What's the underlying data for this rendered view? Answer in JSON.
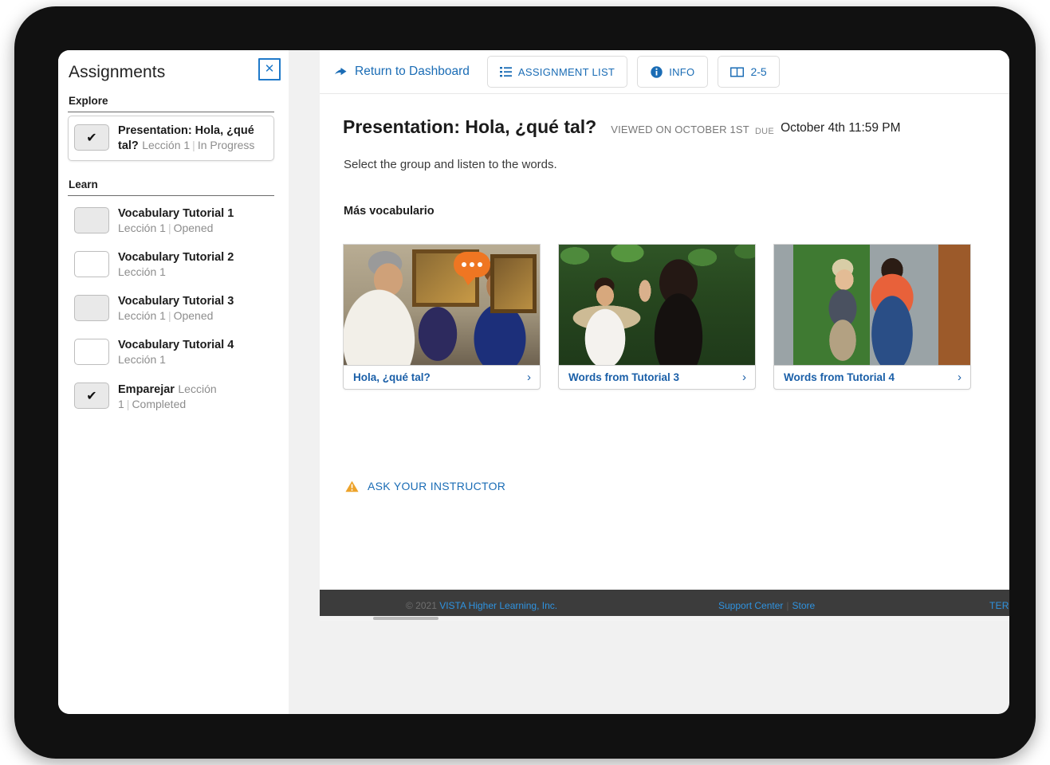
{
  "sidebar": {
    "title": "Assignments",
    "close_icon": "close-icon",
    "groups": [
      {
        "label": "Explore",
        "items": [
          {
            "title": "Presentation: Hola, ¿qué tal?",
            "lesson": "Lección 1",
            "status": "In Progress",
            "state": "checked",
            "selected": true
          }
        ]
      },
      {
        "label": "Learn",
        "items": [
          {
            "title": "Vocabulary Tutorial 1",
            "lesson": "Lección 1",
            "status": "Opened",
            "state": "filled",
            "selected": false
          },
          {
            "title": "Vocabulary Tutorial 2",
            "lesson": "Lección 1",
            "status": "",
            "state": "empty",
            "selected": false
          },
          {
            "title": "Vocabulary Tutorial 3",
            "lesson": "Lección 1",
            "status": "Opened",
            "state": "filled",
            "selected": false
          },
          {
            "title": "Vocabulary Tutorial 4",
            "lesson": "Lección 1",
            "status": "",
            "state": "empty",
            "selected": false
          },
          {
            "title": "Emparejar",
            "lesson": "Lección 1",
            "status": "Completed",
            "state": "checked",
            "selected": false
          }
        ]
      }
    ]
  },
  "toolbar": {
    "return_label": "Return to Dashboard",
    "return_icon": "back-arrow-icon",
    "assignment_list_label": "ASSIGNMENT LIST",
    "assignment_list_icon": "list-icon",
    "info_label": "INFO",
    "info_icon": "info-circle-icon",
    "pages_label": "2-5",
    "pages_icon": "book-icon"
  },
  "main": {
    "activity_title": "Presentation: Hola, ¿qué tal?",
    "viewed_on": "VIEWED ON OCTOBER 1ST",
    "due_label": "DUE",
    "due_value": "October 4th 11:59 PM",
    "instructions": "Select the group and listen to the words.",
    "section_heading": "Más vocabulario",
    "cards": [
      {
        "caption": "Hola, ¿qué tal?",
        "chevron": "chevron-right-icon",
        "has_bubble": true,
        "photo": "p1"
      },
      {
        "caption": "Words from Tutorial 3",
        "chevron": "chevron-right-icon",
        "has_bubble": false,
        "photo": "p2"
      },
      {
        "caption": "Words from Tutorial 4",
        "chevron": "chevron-right-icon",
        "has_bubble": false,
        "photo": "p3"
      }
    ],
    "ask_instructor_label": "ASK YOUR INSTRUCTOR",
    "ask_instructor_icon": "warning-triangle-icon"
  },
  "footer": {
    "copyright_prefix": "© 2021",
    "brand": "VISTA Higher Learning, Inc.",
    "support_center": "Support Center",
    "links_divider": "|",
    "store": "Store",
    "terms": "TERMS"
  },
  "colors": {
    "link_blue": "#1a6cb5",
    "caption_blue": "#1a5fa8",
    "accent_orange": "#ef7622",
    "footer_bg": "#3c3c3c",
    "footer_link": "#2f93e0",
    "bezel": "#111111",
    "screen_bg": "#f1f1f1"
  }
}
